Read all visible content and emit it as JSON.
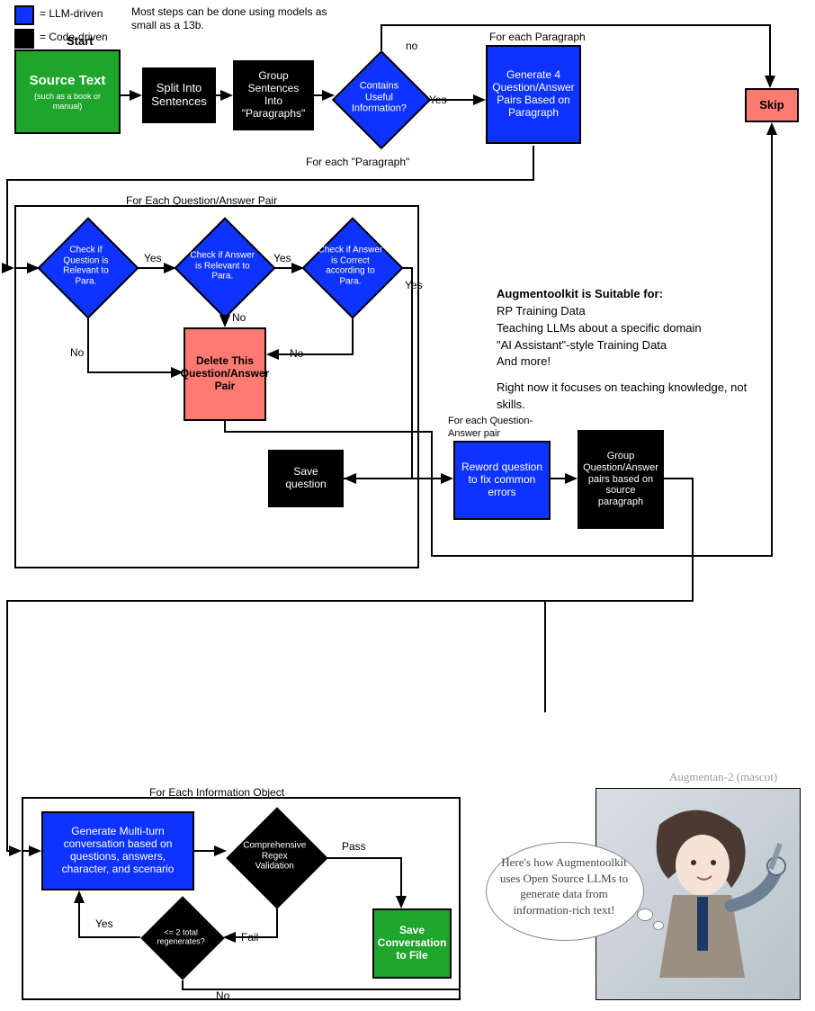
{
  "legend": {
    "llm": "= LLM-driven",
    "code": "= Code-driven"
  },
  "note_top": "Most steps can be done using models as small as a 13b.",
  "start_label": "Start",
  "source_text": "Source Text",
  "source_sub": "(such as a book or manual)",
  "split_sentences": "Split Into Sentences",
  "group_paragraphs": "Group Sentences Into \"Paragraphs\"",
  "for_each_paragraph": "For each \"Paragraph\"",
  "contains_useful": "Contains Useful Information?",
  "yes": "Yes",
  "no": "no",
  "yes_cap": "Yes",
  "no_cap": "No",
  "for_each_paragraph_top": "For each Paragraph",
  "gen4": "Generate 4 Question/Answer Pairs Based on Paragraph",
  "skip": "Skip",
  "section_qa_title": "For Each Question/Answer Pair",
  "check_q_relevant": "Check if Question is Relevant to Para.",
  "check_a_relevant": "Check if Answer is Relevant to Para.",
  "check_a_correct": "Check if Answer is Correct according to Para.",
  "delete_pair": "Delete This Question/Answer Pair",
  "save_question": "Save question",
  "for_each_qa_pair": "For each Question-Answer pair",
  "reword": "Reword question to fix common errors",
  "group_by_source": "Group Question/Answer pairs based on source paragraph",
  "info_block": {
    "title": "Augmentoolkit is Suitable for:",
    "lines": [
      "RP Training Data",
      "Teaching LLMs about a specific domain",
      "\"AI Assistant\"-style Training Data",
      "And more!",
      "",
      "Right now it focuses on teaching knowledge, not skills."
    ]
  },
  "section_info_title": "For Each Information Object",
  "gen_multiturn": "Generate Multi-turn conversation based on questions, answers, character, and scenario",
  "regex_validate": "Comprehensive Regex Validation",
  "pass": "Pass",
  "fail": "Fail",
  "regenerates": "<= 2 total regenerates?",
  "save_conversation": "Save Conversation to File",
  "mascot_caption": "Augmentan-2 (mascot)",
  "mascot_bubble": "Here's how Augmentoolkit uses Open Source LLMs to generate data from information-rich text!"
}
